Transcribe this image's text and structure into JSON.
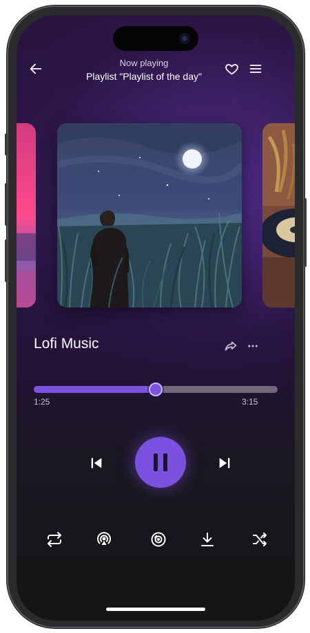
{
  "header": {
    "subtitle": "Now playing",
    "title": "Playlist \"Playlist of the day\""
  },
  "track": {
    "title": "Lofi Music",
    "elapsed": "1:25",
    "duration": "3:15",
    "progress_fraction": 0.5
  },
  "icons": {
    "back": "arrow-left-icon",
    "favorite": "heart-icon",
    "menu": "menu-icon",
    "share": "share-icon",
    "more": "more-horizontal-icon",
    "previous": "skip-back-icon",
    "pause": "pause-icon",
    "next": "skip-forward-icon",
    "repeat": "repeat-icon",
    "airplay": "airplay-icon",
    "vinyl": "vinyl-disc-icon",
    "download": "download-icon",
    "shuffle": "shuffle-icon"
  },
  "colors": {
    "accent": "#7b52e0",
    "track_bg": "#6f6a7a",
    "background_top": "#2a1540",
    "background_bottom": "#151515"
  }
}
